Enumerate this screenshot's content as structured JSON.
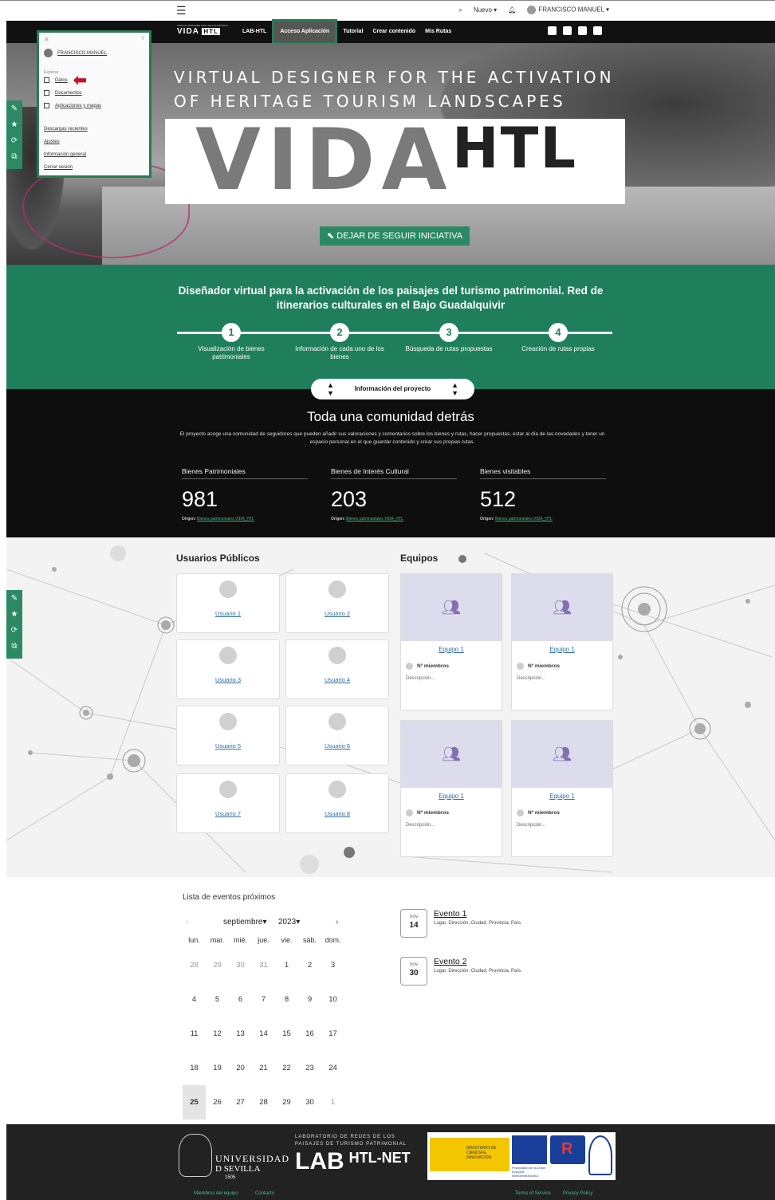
{
  "topbar": {
    "menu_icon": "hamburger-icon",
    "search_icon": "search-icon",
    "new_label": "Nuevo",
    "bell_icon": "bell-icon",
    "user_name": "FRANCISCO MANUEL"
  },
  "nav": {
    "logo_small": "VIRTUAL DESIGNER FOR THE ACTIVATION OF HERITAGE TOURISM LANDSCAPES",
    "logo_word": "VIDA",
    "logo_badge": "HTL",
    "links": [
      "LAB-HTL",
      "Acceso Aplicación",
      "Tutorial",
      "Crear contenido",
      "Mis Rutas"
    ],
    "social": [
      "youtube-icon",
      "instagram-icon",
      "twitter-icon",
      "facebook-icon"
    ]
  },
  "menu": {
    "user": "FRANCISCO MANUEL",
    "section": "Explorar",
    "items": [
      "Datos",
      "Documentos",
      "Aplicaciones y mapas"
    ],
    "links": [
      "Descargas recientes",
      "Ajustes",
      "Información general",
      "Cerrar sesión"
    ]
  },
  "hero": {
    "subtitle_1": "VIRTUAL DESIGNER FOR THE ACTIVATION",
    "subtitle_2": "OF HERITAGE TOURISM LANDSCAPES",
    "word_1": "VIDA",
    "word_2": "HTL",
    "follow_button": "DEJAR DE SEGUIR INICIATIVA"
  },
  "green": {
    "title": "Diseñador virtual para la activación de los paisajes del turismo patrimonial. Red de itinerarios culturales en el Bajo Guadalquivir",
    "steps": [
      {
        "num": "1",
        "label": "Visualización de bienes patrimoniales"
      },
      {
        "num": "2",
        "label": "Información de cada uno de los bienes"
      },
      {
        "num": "3",
        "label": "Búsqueda de rutas propuestas"
      },
      {
        "num": "4",
        "label": "Creación de rutas propias"
      }
    ]
  },
  "community": {
    "info_button": "Información del proyecto",
    "title": "Toda una comunidad detrás",
    "description": "El proyecto acoge una comunidad de seguidores que pueden añadir sus valoraciones y comentarios sobre los bienes y rutas, hacer propuestas, estar al día de las novedades y tener un espacio personal en el que guardar contenido y crear sus propias rutas.",
    "origin_label": "Origen:",
    "origin_link": "Bienes patrimoniales VIDA_HTL",
    "stats": [
      {
        "label": "Bienes Patrimoniales",
        "value": "981"
      },
      {
        "label": "Bienes de Interés Cultural",
        "value": "203"
      },
      {
        "label": "Bienes visitables",
        "value": "512"
      }
    ]
  },
  "users": {
    "title": "Usuarios Públicos",
    "list": [
      "Usuario 1",
      "Usuario 2",
      "Usuario 3",
      "Usuario 4",
      "Usuario 5",
      "Usuario 6",
      "Usuario 7",
      "Usuario 8"
    ]
  },
  "teams": {
    "title": "Equipos",
    "list": [
      {
        "name": "Equipo 1",
        "members": "Nº miembros",
        "desc": "Descripción..."
      },
      {
        "name": "Equipo 1",
        "members": "Nº miembros",
        "desc": "Descripción..."
      },
      {
        "name": "Equipo 1",
        "members": "Nº miembros",
        "desc": "Descripción..."
      },
      {
        "name": "Equipo 1",
        "members": "Nº miembros",
        "desc": "Descripción..."
      }
    ]
  },
  "calendar": {
    "caption": "Lista de eventos próximos",
    "prev": "‹",
    "month": "septiembre",
    "year": "2023",
    "next": "›",
    "weekdays": [
      "lun.",
      "mar.",
      "mié.",
      "jue.",
      "vie.",
      "sáb.",
      "dom."
    ],
    "weeks": [
      [
        "28",
        "29",
        "30",
        "31",
        "1",
        "2",
        "3"
      ],
      [
        "4",
        "5",
        "6",
        "7",
        "8",
        "9",
        "10"
      ],
      [
        "11",
        "12",
        "13",
        "14",
        "15",
        "16",
        "17"
      ],
      [
        "18",
        "19",
        "20",
        "21",
        "22",
        "23",
        "24"
      ],
      [
        "25",
        "26",
        "27",
        "28",
        "29",
        "30",
        "1"
      ]
    ],
    "selected": "25"
  },
  "events": [
    {
      "month": "nov",
      "day": "14",
      "title": "Evento 1",
      "location": "Lugar, Dirección, Ciudad, Provincia, País."
    },
    {
      "month": "nov",
      "day": "30",
      "title": "Evento 2",
      "location": "Lugar, Dirección, Ciudad, Provincia, País."
    }
  ],
  "footer": {
    "university_1": "UNIVERSIDAD",
    "university_2": "D SEVILLA",
    "university_year": "1505",
    "lab_small_1": "LABORATORIO DE REDES DE LOS",
    "lab_small_2": "PAISAJES DE TURISMO PATRIMONIAL",
    "lab_big": "LAB",
    "lab_net": "HTL-NET",
    "ministry": "MINISTERIO DE CIENCIA E INNOVACIÓN",
    "eu_text": "Financiado por la Unión Europea NextGenerationEU",
    "links_left": [
      "Miembros del equipo",
      "Contacto"
    ],
    "links_right": [
      "Terms of Service",
      "Privacy Policy"
    ]
  }
}
